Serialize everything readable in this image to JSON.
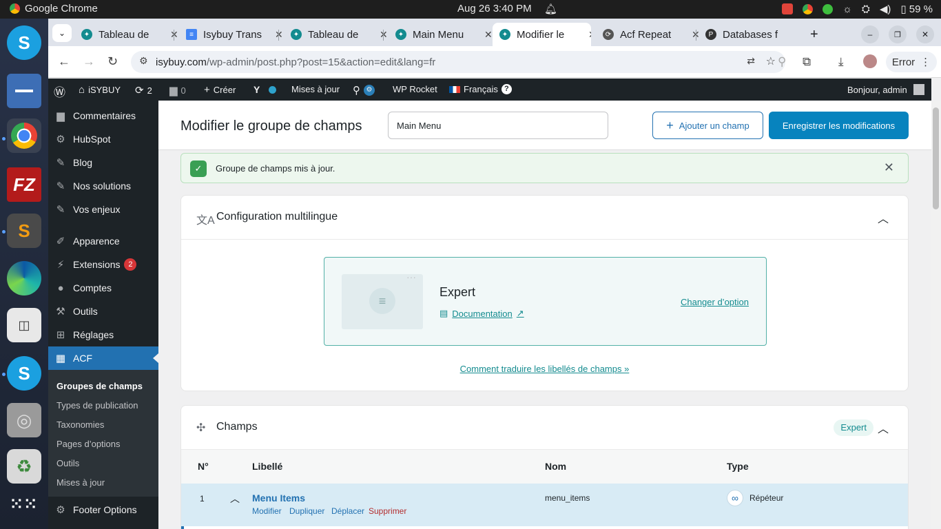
{
  "os": {
    "app_name": "Google Chrome",
    "clock": "Aug 26  3:40 PM",
    "battery": "59 %"
  },
  "chrome": {
    "tabs": [
      {
        "title": "Tableau de",
        "active": false
      },
      {
        "title": "Isybuy Trans",
        "active": false
      },
      {
        "title": "Tableau de",
        "active": false
      },
      {
        "title": "Main Menu",
        "active": false
      },
      {
        "title": "Modifier le",
        "active": true
      },
      {
        "title": "Acf Repeat",
        "active": false
      },
      {
        "title": "Databases f",
        "active": false
      }
    ],
    "url_host": "isybuy.com",
    "url_path": "/wp-admin/post.php?post=15&action=edit&lang=fr",
    "error_label": "Error"
  },
  "adminbar": {
    "site": "iSYBUY",
    "updates": "2",
    "comments": "0",
    "create": "Créer",
    "updates_label": "Mises à jour",
    "wprocket": "WP Rocket",
    "language": "Français",
    "greeting": "Bonjour, admin"
  },
  "sidebar": {
    "items": [
      {
        "label": "Commentaires",
        "icon": "comment-icon"
      },
      {
        "label": "HubSpot",
        "icon": "hubspot-icon"
      },
      {
        "label": "Blog",
        "icon": "pin-icon"
      },
      {
        "label": "Nos solutions",
        "icon": "pin-icon"
      },
      {
        "label": "Vos enjeux",
        "icon": "pin-icon"
      },
      {
        "label": "Apparence",
        "icon": "brush-icon"
      },
      {
        "label": "Extensions",
        "icon": "plugin-icon",
        "badge": "2"
      },
      {
        "label": "Comptes",
        "icon": "user-icon"
      },
      {
        "label": "Outils",
        "icon": "wrench-icon"
      },
      {
        "label": "Réglages",
        "icon": "settings-icon"
      },
      {
        "label": "ACF",
        "icon": "acf-icon",
        "active": true
      }
    ],
    "submenu": [
      "Groupes de champs",
      "Types de publication",
      "Taxonomies",
      "Pages d’options",
      "Outils",
      "Mises à jour"
    ],
    "footer_item": "Footer Options"
  },
  "header": {
    "title": "Modifier le groupe de champs",
    "group_name": "Main Menu",
    "add_field": "Ajouter un champ",
    "save": "Enregistrer les modifications"
  },
  "notice": {
    "message": "Groupe de champs mis à jour."
  },
  "multilingual": {
    "title": "Configuration multilingue",
    "option_title": "Expert",
    "documentation": "Documentation",
    "change_option": "Changer d’option",
    "translate_link": "Comment traduire les libellés de champs »"
  },
  "fields": {
    "title": "Champs",
    "badge": "Expert",
    "columns": {
      "number": "N°",
      "label": "Libellé",
      "name": "Nom",
      "type": "Type"
    },
    "rows": [
      {
        "number": "1",
        "label": "Menu Items",
        "name": "menu_items",
        "type": "Répéteur",
        "actions": {
          "edit": "Modifier",
          "duplicate": "Dupliquer",
          "move": "Déplacer",
          "delete": "Supprimer"
        }
      }
    ]
  },
  "colors": {
    "wp_blue": "#2271b1",
    "acf_teal": "#138b8f",
    "admin_dark": "#1d2327"
  }
}
